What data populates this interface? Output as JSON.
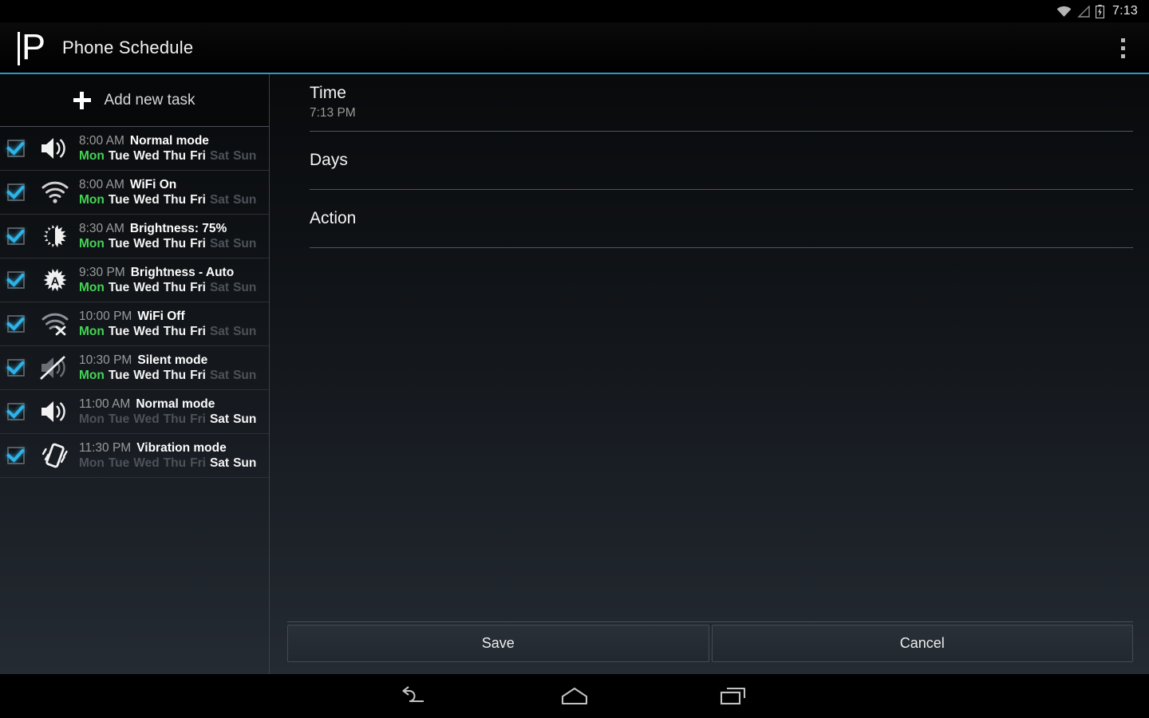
{
  "statusbar": {
    "time": "7:13",
    "icons": [
      "wifi-icon",
      "signal-icon",
      "battery-charging-icon"
    ]
  },
  "actionbar": {
    "logo_letter": "P",
    "title": "Phone Schedule",
    "overflow_name": "overflow-menu-icon"
  },
  "sidebar": {
    "add_task_label": "Add new task",
    "day_labels": [
      "Mon",
      "Tue",
      "Wed",
      "Thu",
      "Fri",
      "Sat",
      "Sun"
    ],
    "tasks": [
      {
        "time": "8:00 AM",
        "name": "Normal mode",
        "icon": "volume-normal-icon",
        "checked": true,
        "days": [
          {
            "label": "Mon",
            "state": "today"
          },
          {
            "label": "Tue",
            "state": "on"
          },
          {
            "label": "Wed",
            "state": "on"
          },
          {
            "label": "Thu",
            "state": "on"
          },
          {
            "label": "Fri",
            "state": "on"
          },
          {
            "label": "Sat",
            "state": "off"
          },
          {
            "label": "Sun",
            "state": "off"
          }
        ]
      },
      {
        "time": "8:00 AM",
        "name": "WiFi On",
        "icon": "wifi-on-icon",
        "checked": true,
        "days": [
          {
            "label": "Mon",
            "state": "today"
          },
          {
            "label": "Tue",
            "state": "on"
          },
          {
            "label": "Wed",
            "state": "on"
          },
          {
            "label": "Thu",
            "state": "on"
          },
          {
            "label": "Fri",
            "state": "on"
          },
          {
            "label": "Sat",
            "state": "off"
          },
          {
            "label": "Sun",
            "state": "off"
          }
        ]
      },
      {
        "time": "8:30 AM",
        "name": "Brightness: 75%",
        "icon": "brightness-icon",
        "checked": true,
        "days": [
          {
            "label": "Mon",
            "state": "today"
          },
          {
            "label": "Tue",
            "state": "on"
          },
          {
            "label": "Wed",
            "state": "on"
          },
          {
            "label": "Thu",
            "state": "on"
          },
          {
            "label": "Fri",
            "state": "on"
          },
          {
            "label": "Sat",
            "state": "off"
          },
          {
            "label": "Sun",
            "state": "off"
          }
        ]
      },
      {
        "time": "9:30 PM",
        "name": "Brightness - Auto",
        "icon": "brightness-auto-icon",
        "checked": true,
        "days": [
          {
            "label": "Mon",
            "state": "today"
          },
          {
            "label": "Tue",
            "state": "on"
          },
          {
            "label": "Wed",
            "state": "on"
          },
          {
            "label": "Thu",
            "state": "on"
          },
          {
            "label": "Fri",
            "state": "on"
          },
          {
            "label": "Sat",
            "state": "off"
          },
          {
            "label": "Sun",
            "state": "off"
          }
        ]
      },
      {
        "time": "10:00 PM",
        "name": "WiFi Off",
        "icon": "wifi-off-icon",
        "checked": true,
        "days": [
          {
            "label": "Mon",
            "state": "today"
          },
          {
            "label": "Tue",
            "state": "on"
          },
          {
            "label": "Wed",
            "state": "on"
          },
          {
            "label": "Thu",
            "state": "on"
          },
          {
            "label": "Fri",
            "state": "on"
          },
          {
            "label": "Sat",
            "state": "off"
          },
          {
            "label": "Sun",
            "state": "off"
          }
        ]
      },
      {
        "time": "10:30 PM",
        "name": "Silent mode",
        "icon": "volume-mute-icon",
        "checked": true,
        "days": [
          {
            "label": "Mon",
            "state": "today"
          },
          {
            "label": "Tue",
            "state": "on"
          },
          {
            "label": "Wed",
            "state": "on"
          },
          {
            "label": "Thu",
            "state": "on"
          },
          {
            "label": "Fri",
            "state": "on"
          },
          {
            "label": "Sat",
            "state": "off"
          },
          {
            "label": "Sun",
            "state": "off"
          }
        ]
      },
      {
        "time": "11:00 AM",
        "name": "Normal mode",
        "icon": "volume-normal-icon",
        "checked": true,
        "days": [
          {
            "label": "Mon",
            "state": "off"
          },
          {
            "label": "Tue",
            "state": "off"
          },
          {
            "label": "Wed",
            "state": "off"
          },
          {
            "label": "Thu",
            "state": "off"
          },
          {
            "label": "Fri",
            "state": "off"
          },
          {
            "label": "Sat",
            "state": "on"
          },
          {
            "label": "Sun",
            "state": "on"
          }
        ]
      },
      {
        "time": "11:30 PM",
        "name": "Vibration mode",
        "icon": "vibration-icon",
        "checked": true,
        "days": [
          {
            "label": "Mon",
            "state": "off"
          },
          {
            "label": "Tue",
            "state": "off"
          },
          {
            "label": "Wed",
            "state": "off"
          },
          {
            "label": "Thu",
            "state": "off"
          },
          {
            "label": "Fri",
            "state": "off"
          },
          {
            "label": "Sat",
            "state": "on"
          },
          {
            "label": "Sun",
            "state": "on"
          }
        ]
      }
    ]
  },
  "detail": {
    "time_label": "Time",
    "time_value": "7:13 PM",
    "days_label": "Days",
    "action_label": "Action",
    "save_label": "Save",
    "cancel_label": "Cancel"
  },
  "navbar": {
    "back": "back-icon",
    "home": "home-icon",
    "recents": "recents-icon"
  },
  "colors": {
    "accent": "#33b5e5",
    "today": "#44d455",
    "checkbox": "#2eb3e8",
    "text_primary": "#f4f4f4",
    "text_dim": "#9a9a9a",
    "text_off": "#4d5259"
  }
}
